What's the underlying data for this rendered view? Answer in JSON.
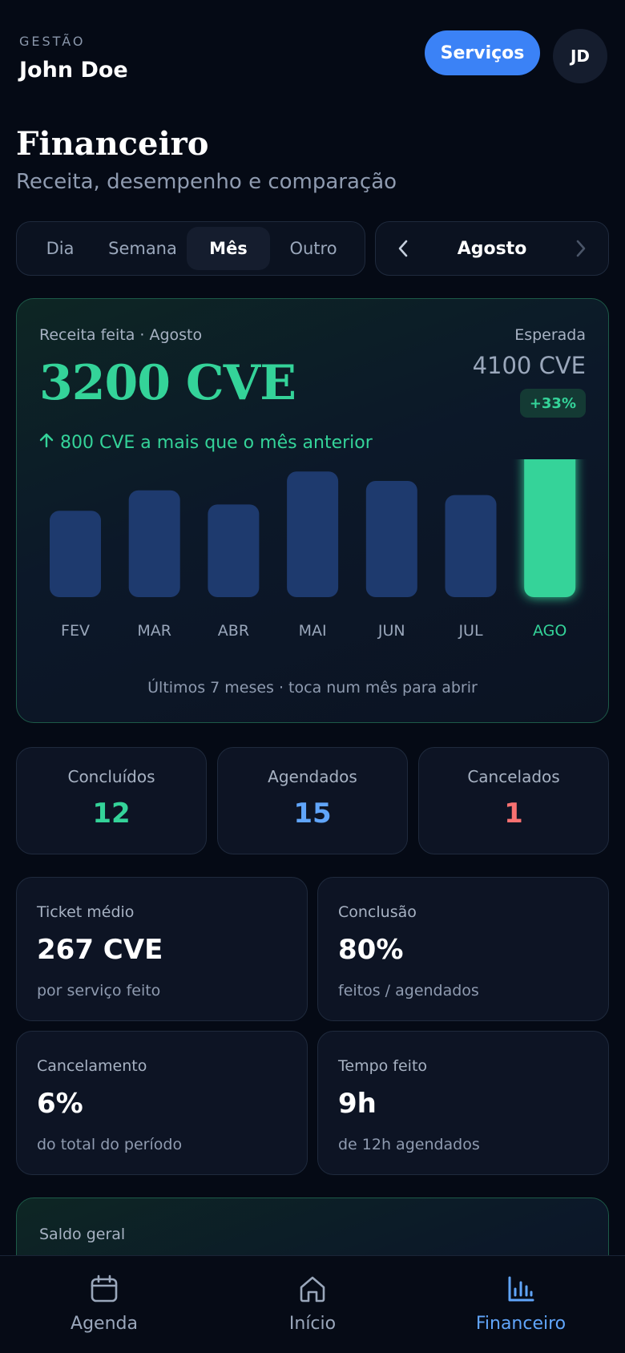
{
  "header": {
    "eyebrow": "GESTÃO",
    "user_name": "John Doe",
    "services_button": "Serviços",
    "avatar_initials": "JD"
  },
  "page": {
    "title": "Financeiro",
    "subtitle": "Receita, desempenho e comparação"
  },
  "period_tabs": {
    "items": [
      "Dia",
      "Semana",
      "Mês",
      "Outro"
    ],
    "active": "Mês"
  },
  "month_picker": {
    "label": "Agosto",
    "prev_icon": "chevron-left-icon",
    "next_icon": "chevron-right-icon"
  },
  "revenue": {
    "caption": "Receita feita · Agosto",
    "amount": "3200 CVE",
    "expected_label": "Esperada",
    "expected_value": "4100 CVE",
    "badge": "+33%",
    "delta_text": "800 CVE a mais que o mês anterior",
    "footer": "Últimos 7 meses · toca num mês para abrir"
  },
  "chart_data": {
    "type": "bar",
    "categories": [
      "FEV",
      "MAR",
      "ABR",
      "MAI",
      "JUN",
      "JUL",
      "AGO"
    ],
    "values": [
      0.55,
      0.68,
      0.59,
      0.8,
      0.74,
      0.65,
      0.99
    ],
    "highlight_index": 6,
    "colors": {
      "bar": "#1e3a6e",
      "highlight": "#34d399",
      "label": "#9aa7bb",
      "highlight_label": "#34d399"
    }
  },
  "counts": [
    {
      "label": "Concluídos",
      "value": "12",
      "color": "#34d399"
    },
    {
      "label": "Agendados",
      "value": "15",
      "color": "#60a5fa"
    },
    {
      "label": "Cancelados",
      "value": "1",
      "color": "#f87171"
    }
  ],
  "metrics": [
    {
      "label": "Ticket médio",
      "value": "267 CVE",
      "sub": "por serviço feito"
    },
    {
      "label": "Conclusão",
      "value": "80%",
      "sub": "feitos / agendados"
    },
    {
      "label": "Cancelamento",
      "value": "6%",
      "sub": "do total do período"
    },
    {
      "label": "Tempo feito",
      "value": "9h",
      "sub": "de 12h agendados"
    }
  ],
  "balance": {
    "label": "Saldo geral"
  },
  "bottom_nav": {
    "items": [
      {
        "label": "Agenda",
        "icon": "calendar-icon"
      },
      {
        "label": "Início",
        "icon": "home-icon"
      },
      {
        "label": "Financeiro",
        "icon": "bar-chart-icon"
      }
    ],
    "active": "Financeiro"
  }
}
